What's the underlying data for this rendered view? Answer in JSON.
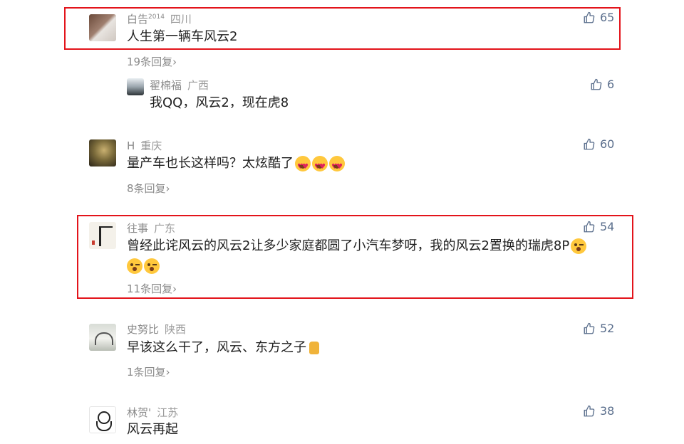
{
  "comments": [
    {
      "name": "白告",
      "name_sup": "2014",
      "location": "四川",
      "text": "人生第一辆车风云2",
      "likes": "65",
      "replies": "19条回复"
    },
    {
      "name": "翟棉福",
      "location": "广西",
      "text": "我QQ，风云2，现在虎8",
      "likes": "6"
    },
    {
      "name": "H",
      "location": "重庆",
      "text": "量产车也长这样吗？太炫酷了",
      "likes": "60",
      "replies": "8条回复"
    },
    {
      "name": "往事",
      "location": "广东",
      "text_line1": "曾经此诧风云的风云2让多少家庭都圆了小汽车梦呀，我的风云2置换的瑞虎8P",
      "likes": "54",
      "replies": "11条回复"
    },
    {
      "name": "史努比",
      "location": "陕西",
      "text": "早该这么干了，风云、东方之子",
      "likes": "52",
      "replies": "1条回复"
    },
    {
      "name": "林贺'",
      "location": "江苏",
      "text": "风云再起",
      "likes": "38"
    }
  ],
  "reply_chevron": "›",
  "colors": {
    "highlight": "#e3141b",
    "like": "#5a6e8c",
    "meta": "#8a8a8a"
  },
  "icons": {
    "like": "thumbs-up-icon",
    "emoji_hearts": "heart-eyes-emoji",
    "emoji_wink": "winking-tongue-emoji",
    "emoji_thumb": "thumbs-up-emoji"
  }
}
